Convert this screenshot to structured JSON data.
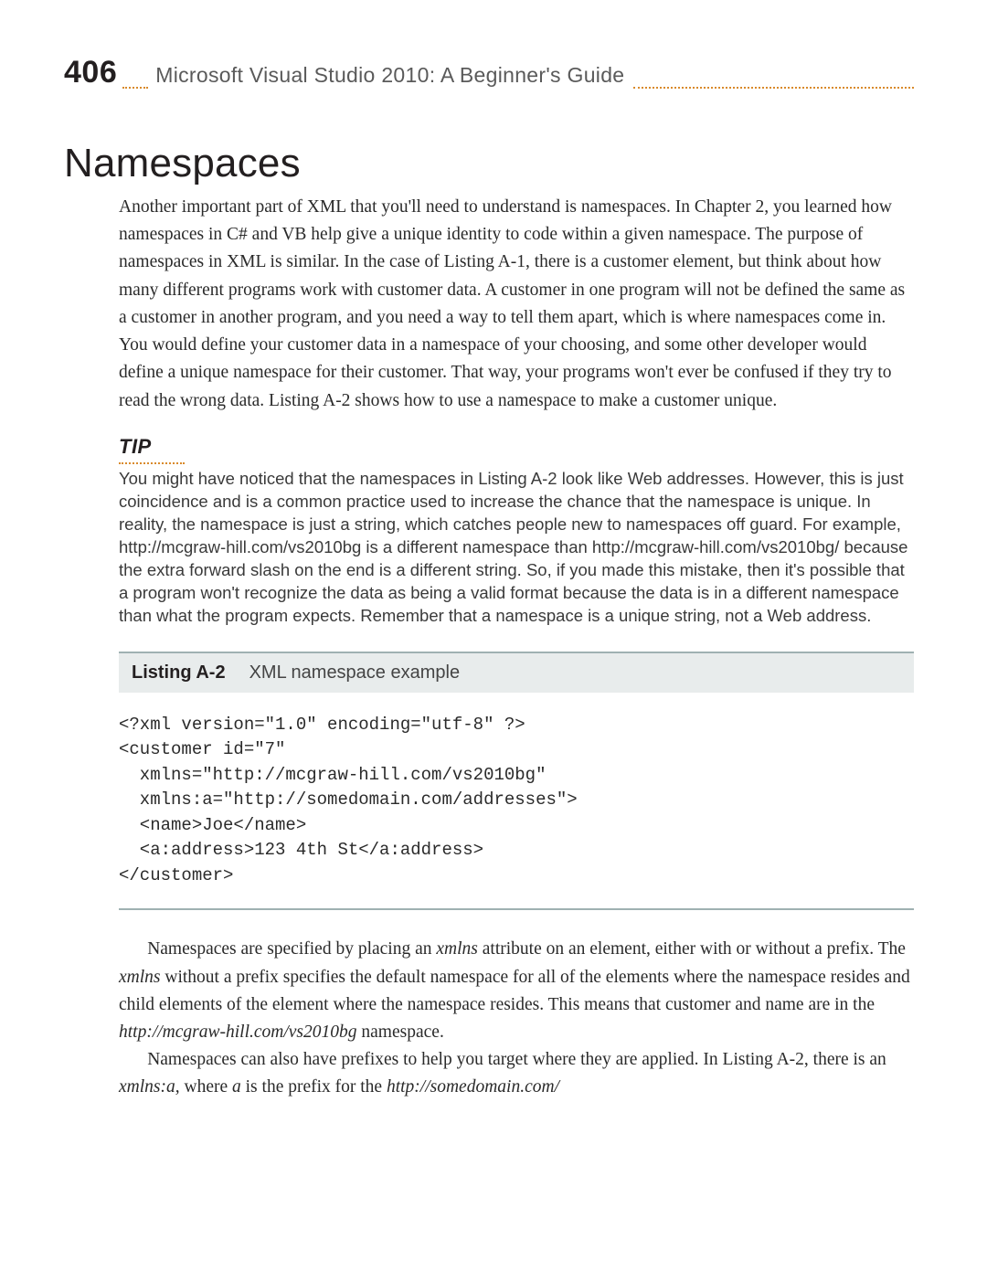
{
  "page": {
    "number": "406",
    "book_title": "Microsoft Visual Studio 2010: A Beginner's Guide"
  },
  "section": {
    "heading": "Namespaces",
    "intro": "Another important part of XML that you'll need to understand is namespaces. In Chapter 2, you learned how namespaces in C# and VB help give a unique identity to code within a given namespace. The purpose of namespaces in XML is similar. In the case of Listing A-1, there is a customer element, but think about how many different programs work with customer data. A customer in one program will not be defined the same as a customer in another program, and you need a way to tell them apart, which is where namespaces come in. You would define your customer data in a namespace of your choosing, and some other developer would define a unique namespace for their customer. That way, your programs won't ever be confused if they try to read the wrong data. Listing A-2 shows how to use a namespace to make a customer unique."
  },
  "tip": {
    "label": "TIP",
    "text": "You might have noticed that the namespaces in Listing A-2 look like Web addresses. However, this is just coincidence and is a common practice used to increase the chance that the namespace is unique. In reality, the namespace is just a string, which catches people new to namespaces off guard. For example, http://mcgraw-hill.com/vs2010bg is a different namespace than http://mcgraw-hill.com/vs2010bg/ because the extra forward slash on the end is a different string. So, if you made this mistake, then it's possible that a program won't recognize the data as being a valid format because the data is in a different namespace than what the program expects. Remember that a namespace is a unique string, not a Web address."
  },
  "listing": {
    "label": "Listing A-2",
    "caption": "XML namespace example",
    "code": "<?xml version=\"1.0\" encoding=\"utf-8\" ?>\n<customer id=\"7\"\n  xmlns=\"http://mcgraw-hill.com/vs2010bg\"\n  xmlns:a=\"http://somedomain.com/addresses\">\n  <name>Joe</name>\n  <a:address>123 4th St</a:address>\n</customer>"
  },
  "after": {
    "p1_pre": "Namespaces are specified by placing an ",
    "p1_i1": "xmlns",
    "p1_mid1": " attribute on an element, either with or without a prefix. The ",
    "p1_i2": "xmlns",
    "p1_mid2": " without a prefix specifies the default namespace for all of the elements where the namespace resides and child elements of the element where the namespace resides. This means that customer and name are in the ",
    "p1_i3": "http://mcgraw-hill.com/vs2010bg",
    "p1_post": " namespace.",
    "p2_pre": "Namespaces can also have prefixes to help you target where they are applied. In Listing A-2, there is an ",
    "p2_i1": "xmlns:a,",
    "p2_mid": " where ",
    "p2_i2": "a",
    "p2_mid2": " is the prefix for the ",
    "p2_i3": "http://somedomain.com/"
  }
}
